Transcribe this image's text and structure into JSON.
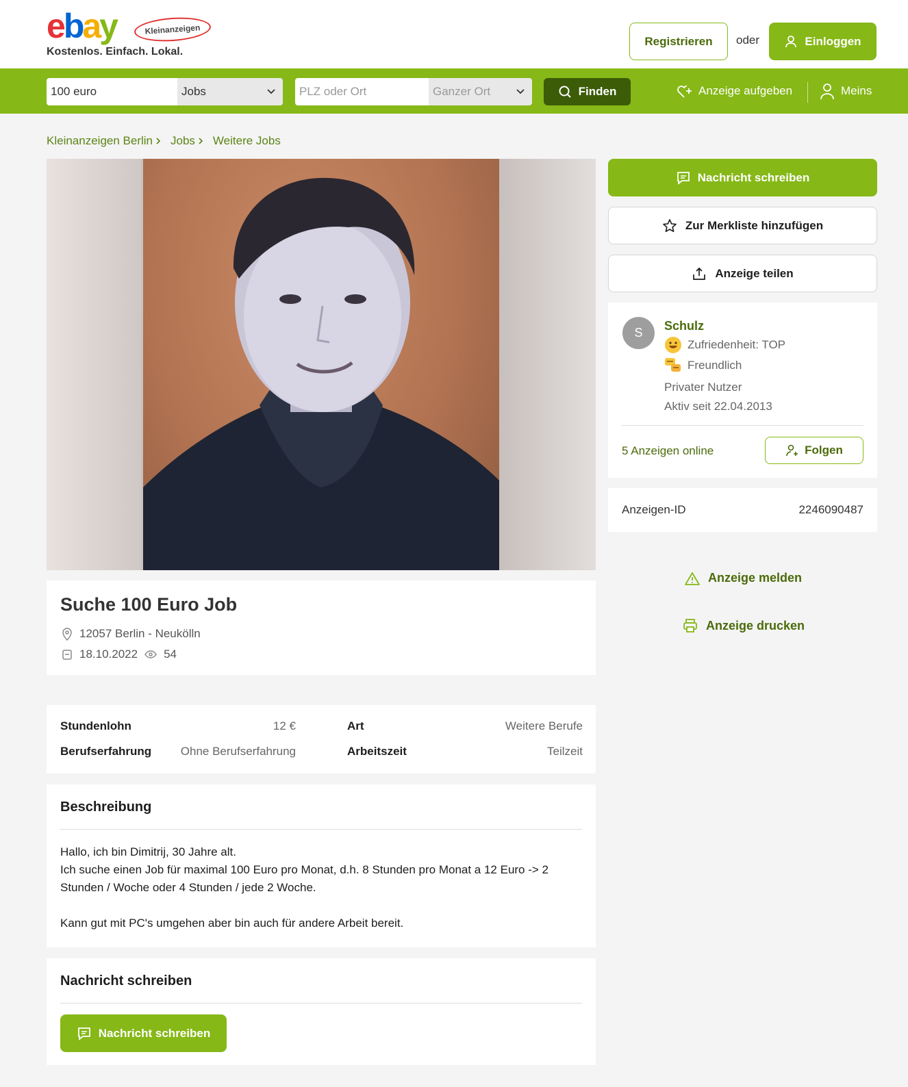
{
  "header": {
    "logo_letters": [
      "e",
      "b",
      "a",
      "y"
    ],
    "logo_colors": [
      "#e53238",
      "#0064d2",
      "#f5af02",
      "#86b817"
    ],
    "logo_badge": "Kleinanzeigen",
    "slogan": "Kostenlos. Einfach. Lokal.",
    "register_label": "Registrieren",
    "or_label": "oder",
    "login_label": "Einloggen"
  },
  "search": {
    "query_value": "100 euro",
    "category_value": "Jobs",
    "location_placeholder": "PLZ oder Ort",
    "radius_value": "Ganzer Ort",
    "find_label": "Finden",
    "post_ad_label": "Anzeige aufgeben",
    "mine_label": "Meins"
  },
  "breadcrumb": [
    "Kleinanzeigen Berlin",
    "Jobs",
    "Weitere Jobs"
  ],
  "ad": {
    "title": "Suche 100 Euro Job",
    "location": "12057 Berlin - Neukölln",
    "date": "18.10.2022",
    "views": "54",
    "details": [
      {
        "label": "Stundenlohn",
        "value": "12 €"
      },
      {
        "label": "Art",
        "value": "Weitere Berufe"
      },
      {
        "label": "Berufserfahrung",
        "value": "Ohne Berufserfahrung"
      },
      {
        "label": "Arbeitszeit",
        "value": "Teilzeit"
      }
    ],
    "description_title": "Beschreibung",
    "description": "Hallo, ich bin Dimitrij, 30 Jahre alt.\nIch suche einen Job für maximal 100 Euro pro Monat, d.h. 8 Stunden pro Monat a 12 Euro -> 2 Stunden / Woche oder 4 Stunden / jede 2 Woche.\n\nKann gut mit PC's umgehen aber bin auch für andere Arbeit bereit.",
    "message_section_title": "Nachricht schreiben",
    "message_button_label": "Nachricht schreiben"
  },
  "sidebar": {
    "message_label": "Nachricht schreiben",
    "watchlist_label": "Zur Merkliste hinzufügen",
    "share_label": "Anzeige teilen",
    "seller": {
      "initial": "S",
      "name": "Schulz",
      "satisfaction": "Zufriedenheit: TOP",
      "friendly": "Freundlich",
      "type": "Privater Nutzer",
      "active_since": "Aktiv seit 22.04.2013",
      "ads_online": "5 Anzeigen online",
      "follow_label": "Folgen"
    },
    "ad_id_label": "Anzeigen-ID",
    "ad_id_value": "2246090487",
    "report_label": "Anzeige melden",
    "print_label": "Anzeige drucken"
  },
  "colors": {
    "brand_green": "#86b817",
    "dark_green": "#3c5c08",
    "link_green": "#4b6b0a"
  }
}
